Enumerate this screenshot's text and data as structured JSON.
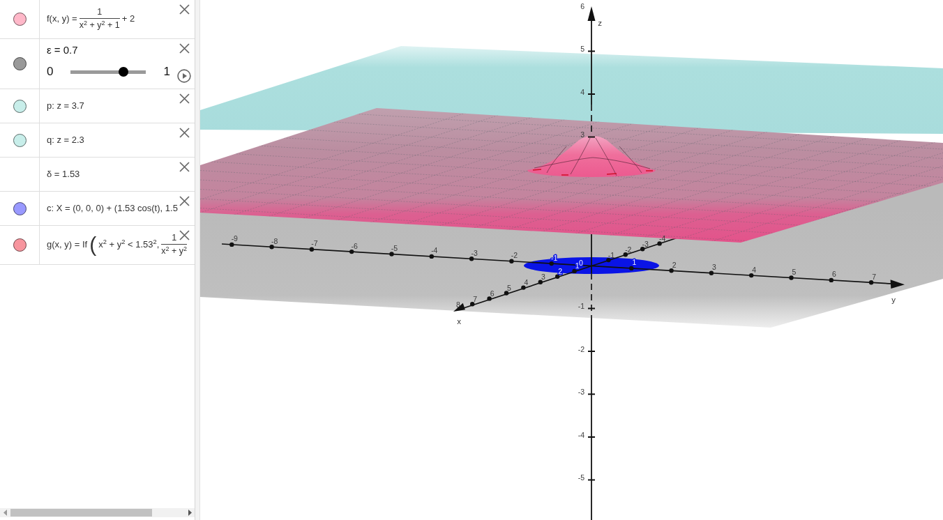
{
  "algebra_view": {
    "items": [
      {
        "kind": "formula",
        "color": "#ffb8c9",
        "parts": [
          {
            "kind": "text",
            "text": "f(x, y) ="
          },
          {
            "kind": "fraction",
            "num": "1",
            "den": "x$^{2}$ + y$^{2}$ + 1"
          },
          {
            "kind": "text",
            "text": "+ 2"
          }
        ]
      },
      {
        "kind": "slider",
        "color": "#999999",
        "label": "ε = 0.7",
        "min": "0",
        "max": "1",
        "level": 0.7
      },
      {
        "kind": "formula",
        "color": "#c8eeea",
        "parts": [
          {
            "kind": "text",
            "text": "p: z = 3.7"
          }
        ]
      },
      {
        "kind": "formula",
        "color": "#c8eeea",
        "parts": [
          {
            "kind": "text",
            "text": "q: z = 2.3"
          }
        ]
      },
      {
        "kind": "formula",
        "parts": [
          {
            "kind": "text",
            "text": "δ = 1.53"
          }
        ]
      },
      {
        "kind": "formula",
        "color": "#9999ff",
        "parts": [
          {
            "kind": "text",
            "text": "c: X = (0, 0, 0) + (1.53 cos(t), 1.5"
          }
        ]
      },
      {
        "kind": "formula",
        "color": "#f7959e",
        "parts": [
          {
            "kind": "text",
            "text": "g(x, y) = If"
          },
          {
            "kind": "paren",
            "text": "("
          },
          {
            "kind": "text",
            "text": "x$^{2}$ + y$^{2}$ < 1.53$^{2}$,"
          },
          {
            "kind": "fraction",
            "num": "1",
            "den": "x$^{2}$ + y$^{2}$"
          }
        ]
      }
    ]
  },
  "graphics_3d": {
    "axes": [
      {
        "name": "x",
        "tick_labels": [
          "8",
          "7",
          "6",
          "5",
          "4",
          "3",
          "2",
          "1",
          "-1",
          "-2",
          "-3",
          "-4"
        ]
      },
      {
        "name": "y",
        "tick_labels": [
          "-9",
          "-8",
          "-7",
          "-6",
          "-5",
          "-4",
          "-3",
          "-2",
          "-1",
          "0",
          "1",
          "2",
          "3",
          "4",
          "5",
          "6",
          "7"
        ]
      },
      {
        "name": "z",
        "tick_labels": [
          "6",
          "5",
          "4",
          "3",
          "-1",
          "-2",
          "-3",
          "-4",
          "-5"
        ]
      }
    ]
  }
}
